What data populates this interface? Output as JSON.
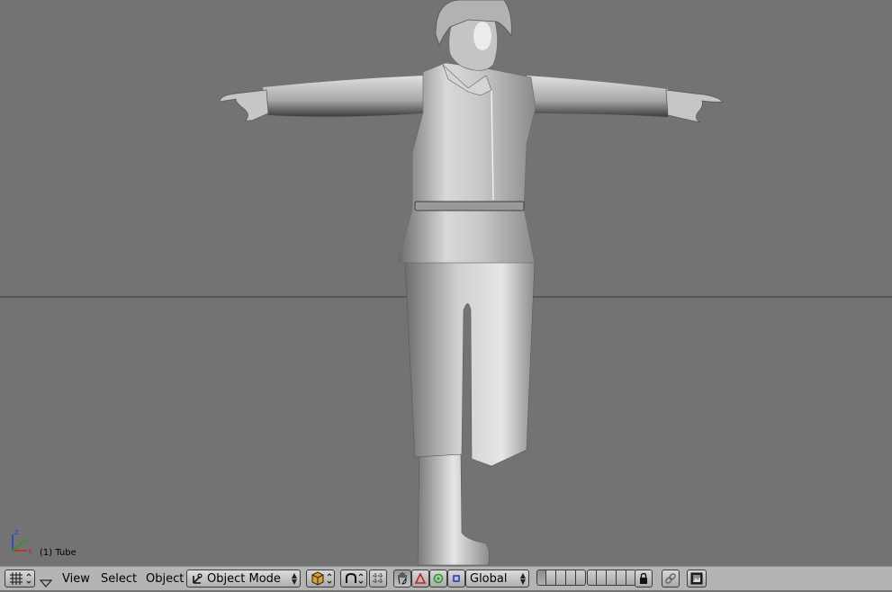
{
  "viewport": {
    "object_label": "(1) Tube",
    "axis_labels": {
      "x": "x",
      "y": "y",
      "z": "z"
    },
    "background_color": "#737373"
  },
  "header": {
    "menus": {
      "view": "View",
      "select": "Select",
      "object": "Object"
    },
    "mode_dropdown": "Object Mode",
    "orientation_dropdown": "Global",
    "icons": [
      "viewport-grid-icon",
      "dropdown-triangle-icon",
      "draw-type-icon",
      "pivot-icon",
      "snap-icon",
      "hand-manipulator-icon",
      "translate-triangle-icon",
      "rotate-circle-icon",
      "scale-square-icon",
      "lock-icon",
      "link-icon",
      "render-icon"
    ]
  }
}
